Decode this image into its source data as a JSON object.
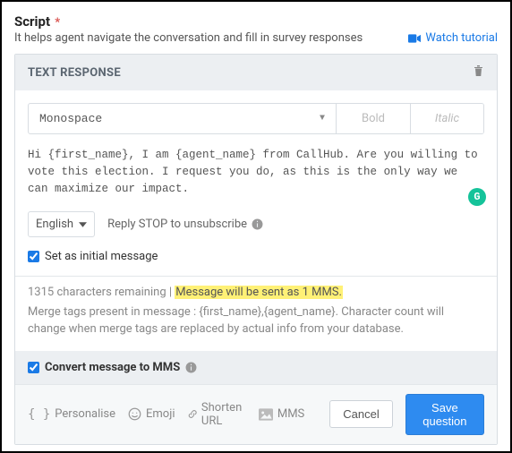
{
  "title": "Script",
  "required_mark": "*",
  "subtitle": "It helps agent navigate the conversation and fill in survey responses",
  "watch_tutorial": "Watch tutorial",
  "card": {
    "title": "TEXT RESPONSE",
    "font_family": "Monospace",
    "bold_label": "Bold",
    "italic_label": "Italic",
    "message": "Hi {first_name}, I am {agent_name} from CallHub. Are you willing to vote this election. I request you do, as this is the only way we can maximize our impact.",
    "grammarly_badge": "G",
    "language": "English",
    "unsubscribe_text": "Reply STOP to unsubscribe",
    "initial_message_label": "Set as initial message",
    "initial_message_checked": true,
    "chars_remaining_text": "1315 characters remaining | ",
    "mms_notice": "Message will be sent as 1 MMS.",
    "merge_tags_text": "Merge tags present in message : {first_name},{agent_name}. Character count will change when merge tags are replaced by actual info from your database.",
    "convert_mms_label": "Convert message to MMS",
    "convert_mms_checked": true
  },
  "footer": {
    "personalise": "Personalise",
    "emoji": "Emoji",
    "shorten": "Shorten URL",
    "mms": "MMS",
    "cancel": "Cancel",
    "save": "Save question"
  }
}
